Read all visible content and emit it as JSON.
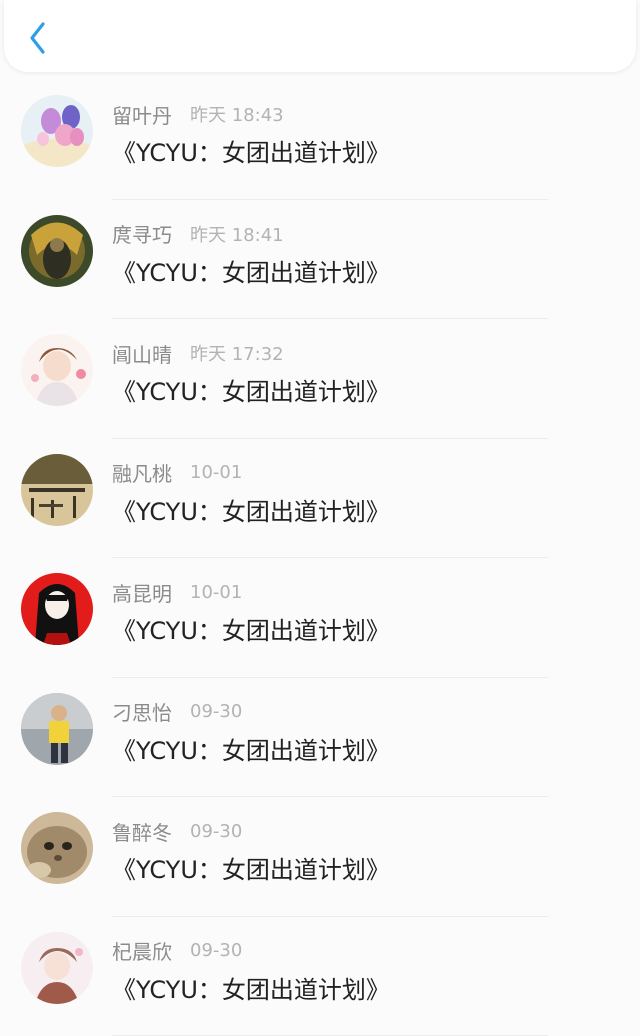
{
  "header": {
    "back_icon": "chevron-left-icon",
    "accent": "#2e9fe6"
  },
  "items": [
    {
      "name": "留叶丹",
      "time": "昨天 18:43",
      "title": "《YCYU：女团出道计划》",
      "avatar": "balloons"
    },
    {
      "name": "庹寻巧",
      "time": "昨天 18:41",
      "title": "《YCYU：女团出道计划》",
      "avatar": "warrior"
    },
    {
      "name": "阊山晴",
      "time": "昨天 17:32",
      "title": "《YCYU：女团出道计划》",
      "avatar": "anime-boy"
    },
    {
      "name": "融凡桃",
      "time": "10-01",
      "title": "《YCYU：女团出道计划》",
      "avatar": "street"
    },
    {
      "name": "高昆明",
      "time": "10-01",
      "title": "《YCYU：女团出道计划》",
      "avatar": "anime-girl-red"
    },
    {
      "name": "刁思怡",
      "time": "09-30",
      "title": "《YCYU：女团出道计划》",
      "avatar": "person-yellow"
    },
    {
      "name": "鲁醉冬",
      "time": "09-30",
      "title": "《YCYU：女团出道计划》",
      "avatar": "cat"
    },
    {
      "name": "杞晨欣",
      "time": "09-30",
      "title": "《YCYU：女团出道计划》",
      "avatar": "anime-pink"
    }
  ]
}
